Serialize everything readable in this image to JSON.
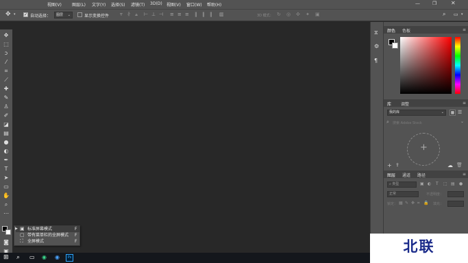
{
  "menubar": {
    "items": [
      "视图(V)",
      "图层(L)",
      "文字(Y)",
      "选择(S)",
      "滤镜(T)",
      "3D(D)",
      "视图(V)",
      "窗口(W)",
      "帮助(H)"
    ]
  },
  "options": {
    "auto_select_label": "自动选择：",
    "auto_select_value": "图层",
    "show_transform_label": "显示变换控件",
    "mode_3d_label": "3D 模式："
  },
  "panels": {
    "color": {
      "tabs": [
        "颜色",
        "色板"
      ]
    },
    "library": {
      "tabs": [
        "库",
        "调整"
      ],
      "library_select": "我的库",
      "search_placeholder": "搜索 Adobe Stock"
    },
    "layers": {
      "tabs": [
        "图层",
        "通道",
        "路径"
      ],
      "kind_filter": "类型",
      "blend_mode": "正常",
      "opacity_label": "不透明度：",
      "lock_label": "锁定：",
      "fill_label": "填充："
    }
  },
  "screen_mode_flyout": {
    "items": [
      {
        "label": "标准屏幕模式",
        "shortcut": "F"
      },
      {
        "label": "带有菜单栏的全屏模式",
        "shortcut": "F"
      },
      {
        "label": "全屏模式",
        "shortcut": "F"
      }
    ],
    "selected_index": 0
  },
  "watermark": {
    "text": "北联"
  },
  "colors": {
    "ui_dark": "#282828",
    "ui_panel": "#535353",
    "taskbar": "#14171c",
    "watermark_text": "#1a2a8a"
  }
}
